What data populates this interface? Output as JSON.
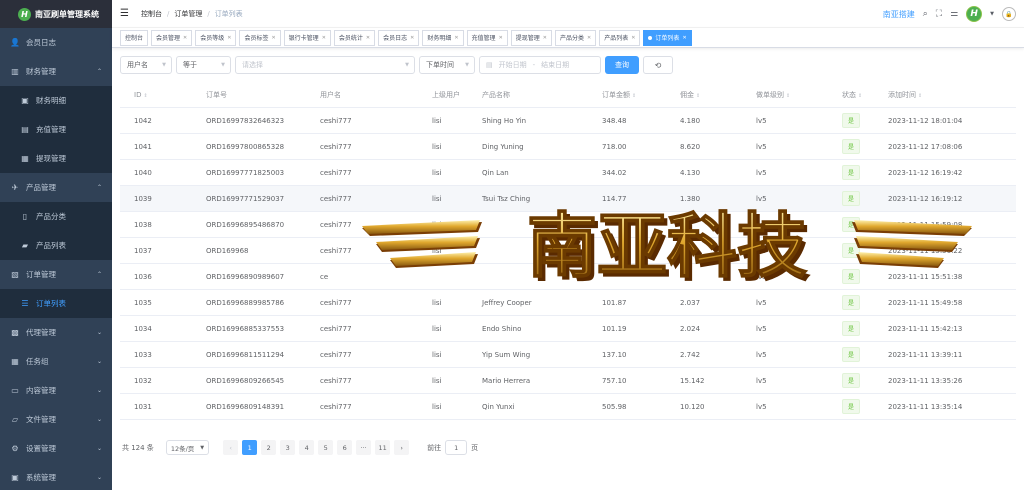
{
  "sidebar": {
    "logo_letter": "H",
    "title": "南亚刷单管理系统",
    "items": [
      {
        "label": "会员日志",
        "icon": "user-icon",
        "glyph": "👤",
        "sub": false,
        "arrow": "",
        "active": false
      },
      {
        "label": "财务管理",
        "icon": "chart-icon",
        "glyph": "▥",
        "sub": false,
        "arrow": "⌃",
        "active": false
      },
      {
        "label": "财务明细",
        "icon": "calendar-icon",
        "glyph": "▣",
        "sub": true,
        "arrow": "",
        "active": false
      },
      {
        "label": "充值管理",
        "icon": "wallet-icon",
        "glyph": "▤",
        "sub": true,
        "arrow": "",
        "active": false
      },
      {
        "label": "提现管理",
        "icon": "withdraw-icon",
        "glyph": "▦",
        "sub": true,
        "arrow": "",
        "active": false
      },
      {
        "label": "产品管理",
        "icon": "send-icon",
        "glyph": "✈",
        "sub": false,
        "arrow": "⌃",
        "active": false
      },
      {
        "label": "产品分类",
        "icon": "document-icon",
        "glyph": "▯",
        "sub": true,
        "arrow": "",
        "active": false
      },
      {
        "label": "产品列表",
        "icon": "bag-icon",
        "glyph": "▰",
        "sub": true,
        "arrow": "",
        "active": false
      },
      {
        "label": "订单管理",
        "icon": "clipboard-icon",
        "glyph": "▧",
        "sub": false,
        "arrow": "⌃",
        "active": false
      },
      {
        "label": "订单列表",
        "icon": "list-icon",
        "glyph": "☰",
        "sub": true,
        "arrow": "",
        "active": true
      },
      {
        "label": "代理管理",
        "icon": "agent-icon",
        "glyph": "▩",
        "sub": false,
        "arrow": "⌄",
        "active": false
      },
      {
        "label": "任务组",
        "icon": "grid-icon",
        "glyph": "▦",
        "sub": false,
        "arrow": "⌄",
        "active": false
      },
      {
        "label": "内容管理",
        "icon": "content-icon",
        "glyph": "▭",
        "sub": false,
        "arrow": "⌄",
        "active": false
      },
      {
        "label": "文件管理",
        "icon": "folder-icon",
        "glyph": "▱",
        "sub": false,
        "arrow": "⌄",
        "active": false
      },
      {
        "label": "设置管理",
        "icon": "gear-icon",
        "glyph": "⚙",
        "sub": false,
        "arrow": "⌄",
        "active": false
      },
      {
        "label": "系统管理",
        "icon": "system-icon",
        "glyph": "▣",
        "sub": false,
        "arrow": "⌄",
        "active": false
      }
    ]
  },
  "navbar": {
    "breadcrumb": [
      "控制台",
      "订单管理",
      "订单列表"
    ],
    "brand": "南亚搭建",
    "avatar_letter": "H"
  },
  "tags": [
    {
      "label": "控制台",
      "closable": false,
      "active": false
    },
    {
      "label": "会员管理",
      "closable": true,
      "active": false
    },
    {
      "label": "会员等级",
      "closable": true,
      "active": false
    },
    {
      "label": "会员标签",
      "closable": true,
      "active": false
    },
    {
      "label": "银行卡管理",
      "closable": true,
      "active": false
    },
    {
      "label": "会员统计",
      "closable": true,
      "active": false
    },
    {
      "label": "会员日志",
      "closable": true,
      "active": false
    },
    {
      "label": "财务明细",
      "closable": true,
      "active": false
    },
    {
      "label": "充值管理",
      "closable": true,
      "active": false
    },
    {
      "label": "提现管理",
      "closable": true,
      "active": false
    },
    {
      "label": "产品分类",
      "closable": true,
      "active": false
    },
    {
      "label": "产品列表",
      "closable": true,
      "active": false
    },
    {
      "label": "订单列表",
      "closable": true,
      "active": true
    }
  ],
  "filters": {
    "field": "用户名",
    "operator": "等于",
    "value_placeholder": "请选择",
    "time_field": "下单时间",
    "start_placeholder": "开始日期",
    "range_sep": "-",
    "end_placeholder": "结束日期",
    "search_label": "查询",
    "refresh_glyph": "⟲"
  },
  "table": {
    "headers": [
      "ID",
      "订单号",
      "用户名",
      "上级用户",
      "产品名称",
      "订单金额",
      "佣金",
      "做单级别",
      "状态",
      "添加时间"
    ],
    "sortable": [
      true,
      false,
      false,
      false,
      false,
      true,
      true,
      true,
      true,
      true
    ],
    "rows": [
      [
        "1042",
        "ORD16997832646323",
        "ceshi777",
        "lisi",
        "Shing Ho Yin",
        "348.48",
        "4.180",
        "lv5",
        "是",
        "2023-11-12 18:01:04"
      ],
      [
        "1041",
        "ORD16997800865328",
        "ceshi777",
        "lisi",
        "Ding Yuning",
        "718.00",
        "8.620",
        "lv5",
        "是",
        "2023-11-12 17:08:06"
      ],
      [
        "1040",
        "ORD16997771825003",
        "ceshi777",
        "lisi",
        "Qin Lan",
        "344.02",
        "4.130",
        "lv5",
        "是",
        "2023-11-12 16:19:42"
      ],
      [
        "1039",
        "ORD16997771529037",
        "ceshi777",
        "lisi",
        "Tsui Tsz Ching",
        "114.77",
        "1.380",
        "lv5",
        "是",
        "2023-11-12 16:19:12"
      ],
      [
        "1038",
        "ORD16996895486870",
        "ceshi777",
        "lisi",
        "",
        "",
        "",
        "lv5",
        "是",
        "2023-11-11 15:59:08"
      ],
      [
        "1037",
        "ORD169968",
        "ceshi777",
        "lisi",
        "",
        "",
        "",
        "lv5",
        "是",
        "2023-11-11 15:56:22"
      ],
      [
        "1036",
        "ORD16996890989607",
        "ce",
        "",
        "",
        "",
        "",
        "lv5",
        "是",
        "2023-11-11 15:51:38"
      ],
      [
        "1035",
        "ORD16996889985786",
        "ceshi777",
        "lisi",
        "Jeffrey Cooper",
        "101.87",
        "2.037",
        "lv5",
        "是",
        "2023-11-11 15:49:58"
      ],
      [
        "1034",
        "ORD16996885337553",
        "ceshi777",
        "lisi",
        "Endo Shino",
        "101.19",
        "2.024",
        "lv5",
        "是",
        "2023-11-11 15:42:13"
      ],
      [
        "1033",
        "ORD16996811511294",
        "ceshi777",
        "lisi",
        "Yip Sum Wing",
        "137.10",
        "2.742",
        "lv5",
        "是",
        "2023-11-11 13:39:11"
      ],
      [
        "1032",
        "ORD16996809266545",
        "ceshi777",
        "lisi",
        "Mario Herrera",
        "757.10",
        "15.142",
        "lv5",
        "是",
        "2023-11-11 13:35:26"
      ],
      [
        "1031",
        "ORD16996809148391",
        "ceshi777",
        "lisi",
        "Qin Yunxi",
        "505.98",
        "10.120",
        "lv5",
        "是",
        "2023-11-11 13:35:14"
      ]
    ],
    "hover_row": 3
  },
  "pagination": {
    "total": "共 124 条",
    "size": "12条/页",
    "pages": [
      "1",
      "2",
      "3",
      "4",
      "5",
      "6",
      "···",
      "11"
    ],
    "current": "1",
    "goto_label": "前往",
    "goto_value": "1",
    "page_unit": "页"
  },
  "watermark": {
    "text": "南亚科技"
  }
}
